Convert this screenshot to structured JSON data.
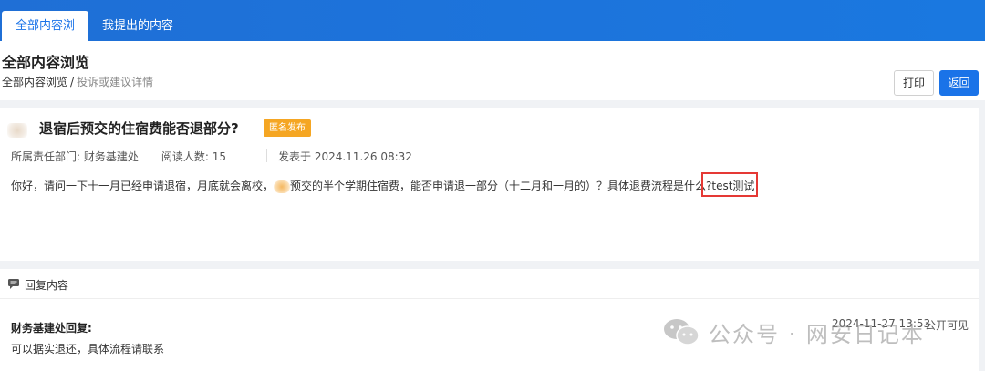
{
  "tabs": [
    {
      "label": "全部内容浏览",
      "active": true
    },
    {
      "label": "我提出的内容",
      "active": false
    }
  ],
  "header": {
    "title": "全部内容浏览",
    "breadcrumb": {
      "root": "全部内容浏览",
      "separator": "/",
      "current": "投诉或建议详情"
    },
    "print_label": "打印",
    "back_label": "返回"
  },
  "post": {
    "title": "退宿后预交的住宿费能否退部分?",
    "badge": "匿名发布",
    "department": "所属责任部门: 财务基建处",
    "reads": "阅读人数: 15",
    "published": "发表于 2024.11.26 08:32",
    "body_before": "你好，请问一下十一月已经申请退宿，月底就会离校，",
    "body_after": "预交的半个学期住宿费，能否申请退一部分（十二月和一月的）？具体退费流程是什么?",
    "body_highlight": "test测试"
  },
  "reply": {
    "section_label": "回复内容",
    "department": "财务基建处回复:",
    "text": "可以据实退还，具体流程请联系",
    "time": "2024-11-27 13:53",
    "visibility": "公开可见"
  },
  "watermark": {
    "text": "公众号 · 网安日记本"
  },
  "colors": {
    "primary": "#1a73e8",
    "badge": "#f5a623",
    "highlight_border": "#e53935"
  }
}
